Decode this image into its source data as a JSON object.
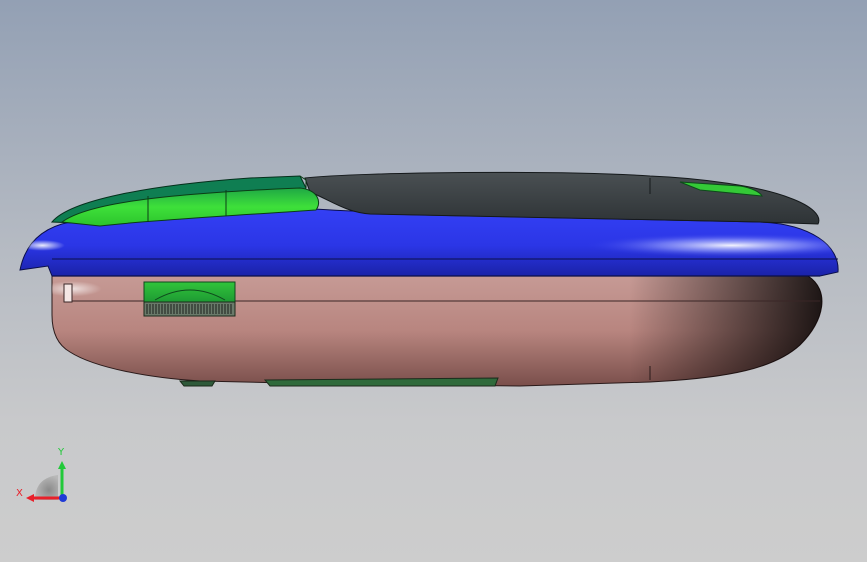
{
  "viewport": {
    "background_top": "#93a0b4",
    "background_bottom": "#cdcdcd"
  },
  "model": {
    "upper_shell_color": "#2f3cf0",
    "lower_shell_color": "#b98a85",
    "top_cover_color": "#3d4346",
    "button_color": "#2fd22f",
    "button_dark_color": "#0f6e3e"
  },
  "triad": {
    "x_label": "X",
    "y_label": "Y",
    "x_color": "#e8202a",
    "y_color": "#22c93a",
    "z_color": "#1f3ad6"
  }
}
